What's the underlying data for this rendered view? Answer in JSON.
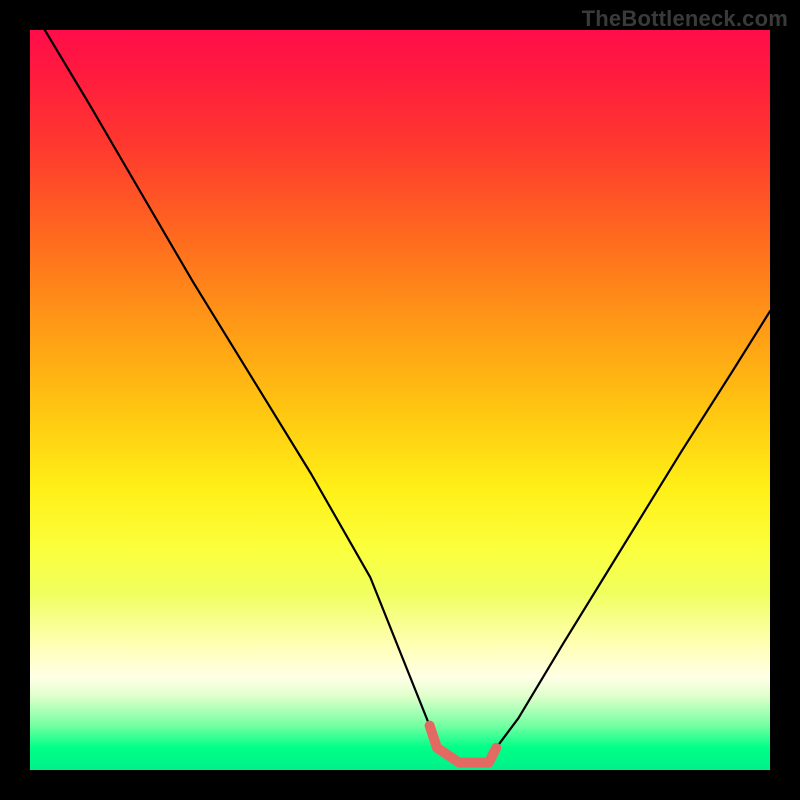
{
  "watermark": "TheBottleneck.com",
  "chart_data": {
    "type": "line",
    "title": "",
    "xlabel": "",
    "ylabel": "",
    "xlim": [
      0,
      100
    ],
    "ylim": [
      0,
      100
    ],
    "series": [
      {
        "name": "bottleneck-curve",
        "x": [
          2,
          8,
          15,
          22,
          30,
          38,
          46,
          50,
          54,
          55,
          58,
          62,
          63,
          66,
          72,
          80,
          88,
          95,
          100
        ],
        "values": [
          100,
          90,
          78,
          66,
          53,
          40,
          26,
          16,
          6,
          3,
          1,
          1,
          3,
          7,
          17,
          30,
          43,
          54,
          62
        ]
      }
    ],
    "highlight_segment": {
      "name": "optimal-zone",
      "x": [
        54,
        55,
        58,
        62,
        63
      ],
      "values": [
        6,
        3,
        1,
        1,
        3
      ]
    },
    "grid": false,
    "legend": false
  },
  "colors": {
    "curve": "#000000",
    "highlight": "#e36a62",
    "frame": "#000000"
  }
}
